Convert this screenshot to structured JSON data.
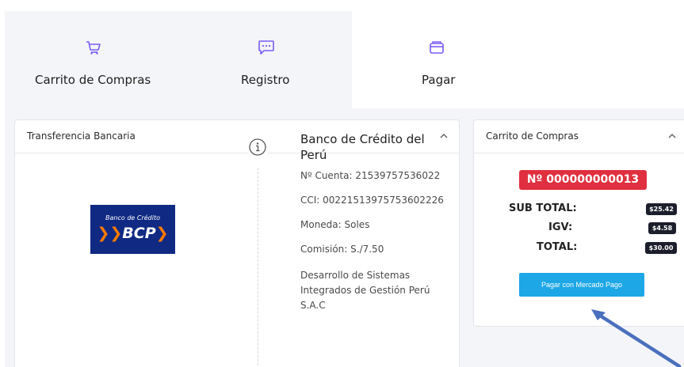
{
  "stepper": {
    "steps": [
      {
        "label": "Carrito de Compras",
        "icon": "cart-icon"
      },
      {
        "label": "Registro",
        "icon": "chat-icon"
      },
      {
        "label": "Pagar",
        "icon": "wallet-icon"
      }
    ],
    "accent": "#7b5cf5"
  },
  "transfer": {
    "title": "Transferencia Bancaria",
    "logo": {
      "small_text": "Banco de Crédito",
      "big_text": "BCP"
    },
    "bank_name": "Banco de Crédito del Perú",
    "cuenta": "Nº Cuenta: 21539757536022",
    "cci": "CCI: 00221513975753602226",
    "moneda": "Moneda: Soles",
    "comision": "Comisión: S./7.50",
    "titular": "Desarrollo de Sistemas Integrados de Gestión Perú S.A.C"
  },
  "cart": {
    "title": "Carrito de Compras",
    "order_number": "Nº 000000000013",
    "subtotal_label": "SUB TOTAL:",
    "subtotal_value": "$25.42",
    "igv_label": "IGV:",
    "igv_value": "$4.58",
    "total_label": "TOTAL:",
    "total_value": "$30.00",
    "pay_button": "Pagar con Mercado Pago"
  },
  "colors": {
    "badge_red": "#e0303f",
    "button_blue": "#1da7e6",
    "logo_blue": "#102a83",
    "arrow_blue": "#4a6fbd"
  }
}
